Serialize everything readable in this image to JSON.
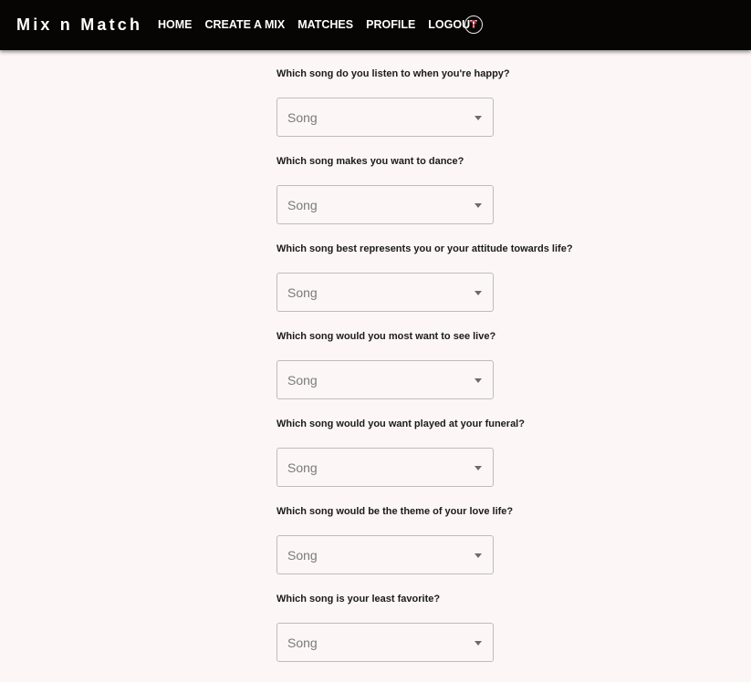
{
  "navbar": {
    "brand": "Mix n Match",
    "links": [
      "HOME",
      "CREATE A MIX",
      "MATCHES",
      "PROFILE",
      "LOGOUT"
    ],
    "help_icon": "question-circle-icon",
    "help_glyph": "?",
    "colors": {
      "background": "#060504",
      "text": "#ffffff",
      "help_accent": "#c8283a"
    }
  },
  "form": {
    "questions": [
      {
        "label": "Which song do you listen to when you're happy?",
        "select_value": "Song"
      },
      {
        "label": "Which song makes you want to dance?",
        "select_value": "Song"
      },
      {
        "label": "Which song best represents you or your attitude towards life?",
        "select_value": "Song"
      },
      {
        "label": "Which song would you most want to see live?",
        "select_value": "Song"
      },
      {
        "label": "Which song would you want played at your funeral?",
        "select_value": "Song"
      },
      {
        "label": "Which song would be the theme of your love life?",
        "select_value": "Song"
      },
      {
        "label": "Which song is your least favorite?",
        "select_value": "Song"
      }
    ]
  },
  "colors": {
    "page_background": "#fdf6f6"
  }
}
